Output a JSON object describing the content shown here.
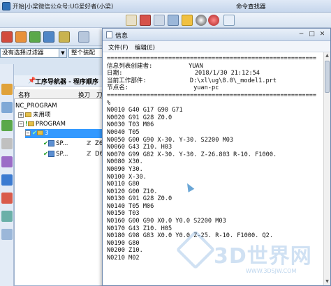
{
  "app": {
    "title": "开始|小梁微信公众号:UG爱好者(小梁)",
    "command_finder": "命令查找器"
  },
  "filter": {
    "selected": "没有选择过滤器",
    "assembly": "整个装配"
  },
  "navigator": {
    "title": "工序导航器 - 程序顺序",
    "columns": [
      "名称",
      "换刀",
      "刀"
    ],
    "rows": [
      {
        "label": "NC_PROGRAM",
        "indent": 0
      },
      {
        "label": "未用项",
        "indent": 1
      },
      {
        "label": "PROGRAM",
        "indent": 1
      },
      {
        "label": "3",
        "indent": 2
      },
      {
        "label": "SP...",
        "indent": 3,
        "tool": "Z6"
      },
      {
        "label": "SP...",
        "indent": 3,
        "tool": "D6"
      }
    ]
  },
  "dialog": {
    "title": "信息",
    "menu": [
      "文件(F)",
      "编辑(E)"
    ],
    "lines": [
      "==========================================================",
      "信息列表创建者:          YUAN",
      "日期:                    2018/1/30 21:12:54",
      "当前工作部件:            D:\\xl\\ug\\8.0\\_model1.prt",
      "节点名:                  yuan-pc",
      "==========================================================",
      "%",
      "N0010 G40 G17 G90 G71",
      "N0020 G91 G28 Z0.0",
      "N0030 T03 M06",
      "N0040 T05",
      "N0050 G00 G90 X-30. Y-30. S2200 M03",
      "N0060 G43 Z10. H03",
      "N0070 G99 G82 X-30. Y-30. Z-26.803 R-10. F1000.",
      "N0080 X30.",
      "N0090 Y30.",
      "N0100 X-30.",
      "N0110 G80",
      "N0120 G00 Z10.",
      "N0130 G91 G28 Z0.0",
      "N0140 T05 M06",
      "N0150 T03",
      "N0160 G00 G90 X0.0 Y0.0 S2200 M03",
      "N0170 G43 Z10. H05",
      "N0180 G98 G83 X0.0 Y0.0 Z-25. R-10. F1000. Q2.",
      "N0190 G80",
      "N0200 Z10.",
      "N0210 M02"
    ]
  },
  "watermark": {
    "text": "3D世界网",
    "sub": "WWW.3DSJW.COM"
  },
  "colors": {
    "selection": "#3399ff",
    "check": "#1b9b1b"
  }
}
